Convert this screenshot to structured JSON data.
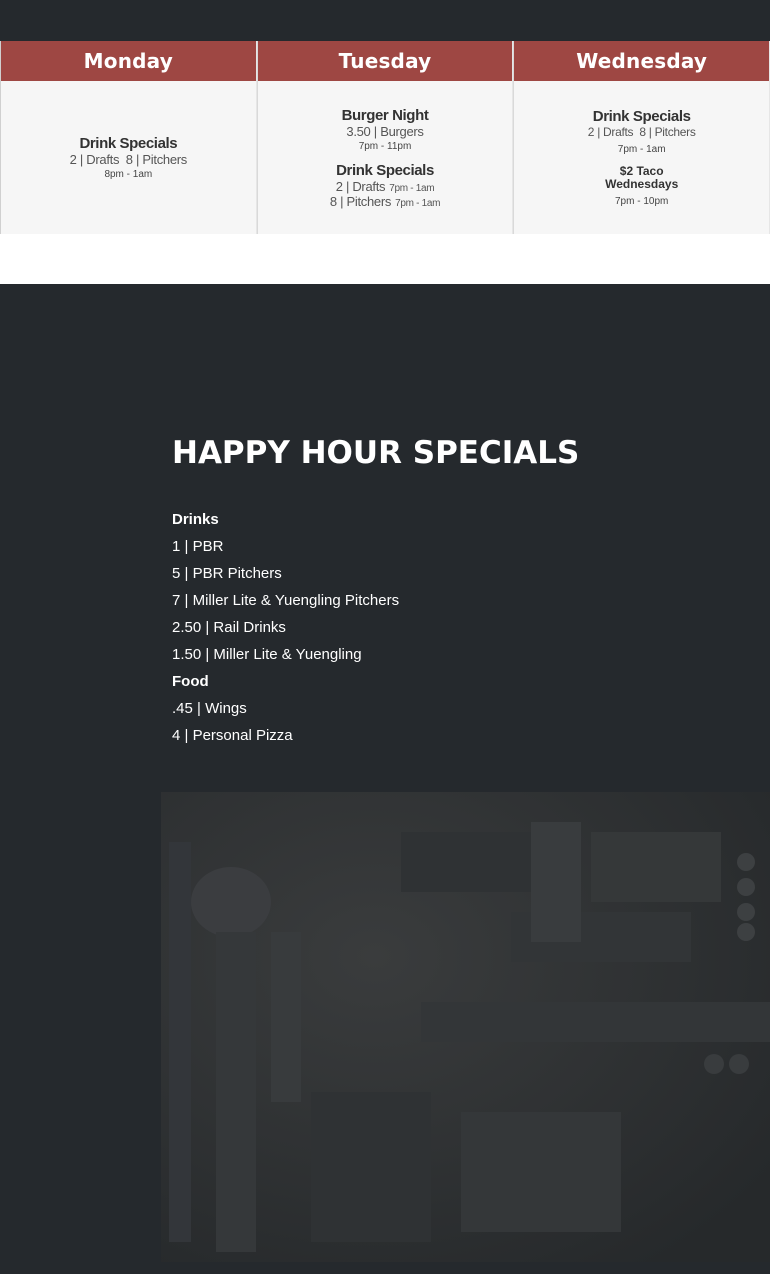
{
  "schedule": {
    "monday": {
      "day": "Monday",
      "title": "Drink Specials",
      "line": "2 | Drafts  8 | Pitchers",
      "time": "8pm - 1am"
    },
    "tuesday": {
      "day": "Tuesday",
      "burger_title": "Burger Night",
      "burger_line": "3.50 | Burgers",
      "burger_time": "7pm - 11pm",
      "drink_title": "Drink Specials",
      "drafts": "2 | Drafts",
      "drafts_time": "7pm - 1am",
      "pitchers": "8 | Pitchers",
      "pitchers_time": "7pm - 1am"
    },
    "wednesday": {
      "day": "Wednesday",
      "title": "Drink Specials",
      "line": "2 | Drafts  8 | Pitchers",
      "time": "7pm - 1am",
      "taco_line1": "$2 Taco",
      "taco_line2": "Wednesdays",
      "taco_time": "7pm - 10pm"
    }
  },
  "happy_hour": {
    "title": "HAPPY HOUR SPECIALS",
    "drinks_heading": "Drinks",
    "drinks": [
      "1 | PBR",
      "5 | PBR Pitchers",
      "7 | Miller Lite & Yuengling Pitchers",
      "2.50 | Rail Drinks",
      "1.50 | Miller Lite & Yuengling"
    ],
    "food_heading": "Food",
    "food": [
      ".45 | Wings",
      "4 | Personal Pizza"
    ]
  },
  "colors": {
    "header_red": "#9e4743",
    "dark_background": "#25292d"
  }
}
